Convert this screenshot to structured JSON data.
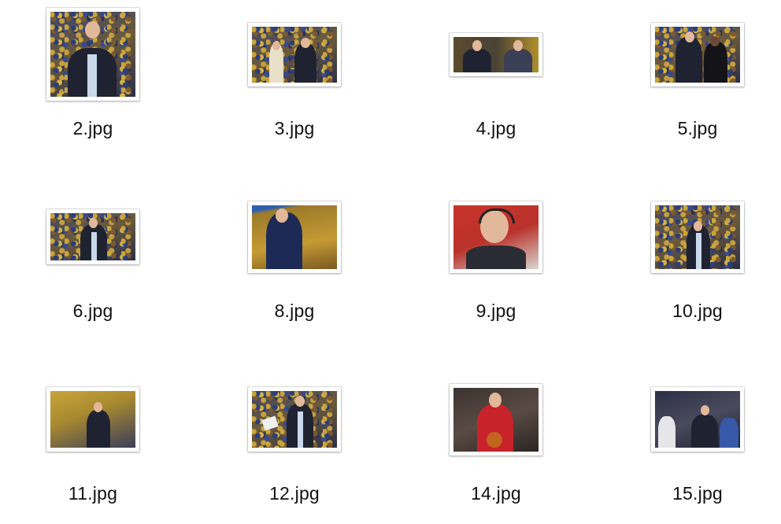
{
  "files": [
    {
      "name": "2.jpg",
      "theme": "crowd"
    },
    {
      "name": "3.jpg",
      "theme": "crowd"
    },
    {
      "name": "4.jpg",
      "theme": "crowd"
    },
    {
      "name": "5.jpg",
      "theme": "crowd"
    },
    {
      "name": "6.jpg",
      "theme": "crowd"
    },
    {
      "name": "8.jpg",
      "theme": "crowd"
    },
    {
      "name": "9.jpg",
      "theme": "red"
    },
    {
      "name": "10.jpg",
      "theme": "crowd"
    },
    {
      "name": "11.jpg",
      "theme": "crowd"
    },
    {
      "name": "12.jpg",
      "theme": "crowd"
    },
    {
      "name": "14.jpg",
      "theme": "dark"
    },
    {
      "name": "15.jpg",
      "theme": "crowd"
    }
  ]
}
